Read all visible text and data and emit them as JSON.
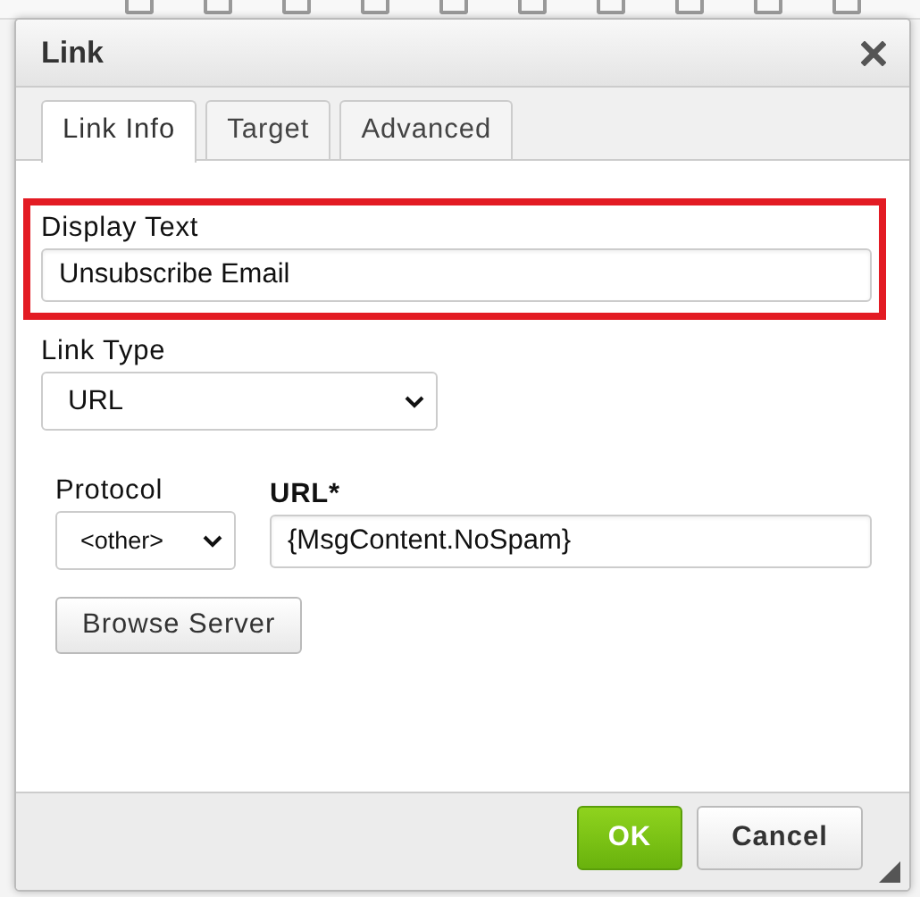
{
  "dialog": {
    "title": "Link"
  },
  "tabs": [
    {
      "label": "Link Info",
      "selected": true
    },
    {
      "label": "Target",
      "selected": false
    },
    {
      "label": "Advanced",
      "selected": false
    }
  ],
  "fields": [
    {
      "kind": "text",
      "label": "Display Text",
      "value": "Unsubscribe Email",
      "highlighted": true
    },
    {
      "kind": "select",
      "label": "Link Type",
      "value": "URL",
      "highlighted": false
    }
  ],
  "protocol": {
    "label": "Protocol",
    "value": "<other>"
  },
  "url": {
    "label": "URL*",
    "value": "{MsgContent.NoSpam}"
  },
  "browse_button": "Browse Server",
  "buttons": [
    {
      "kind": "primary",
      "label": "OK"
    },
    {
      "kind": "secondary",
      "label": "Cancel"
    }
  ]
}
